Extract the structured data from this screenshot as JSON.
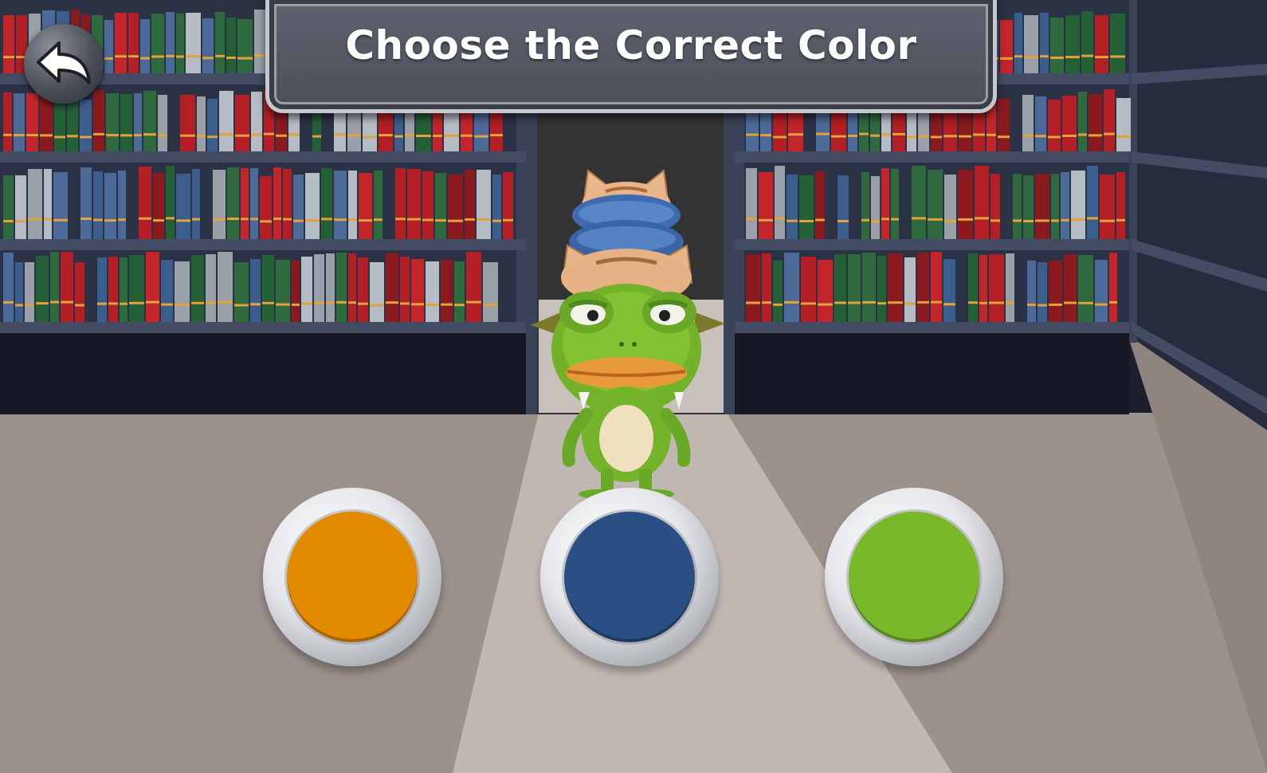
{
  "header": {
    "title": "Choose the Correct Color"
  },
  "back_button": {
    "icon": "back-arrow-icon"
  },
  "answers": [
    {
      "color_name": "orange",
      "color": "#E48A00"
    },
    {
      "color_name": "blue",
      "color": "#2A4F84"
    },
    {
      "color_name": "green",
      "color": "#78B829"
    }
  ],
  "scene": {
    "character": "frog-with-stacked-animal-hats",
    "background": "library-bookshelves"
  }
}
